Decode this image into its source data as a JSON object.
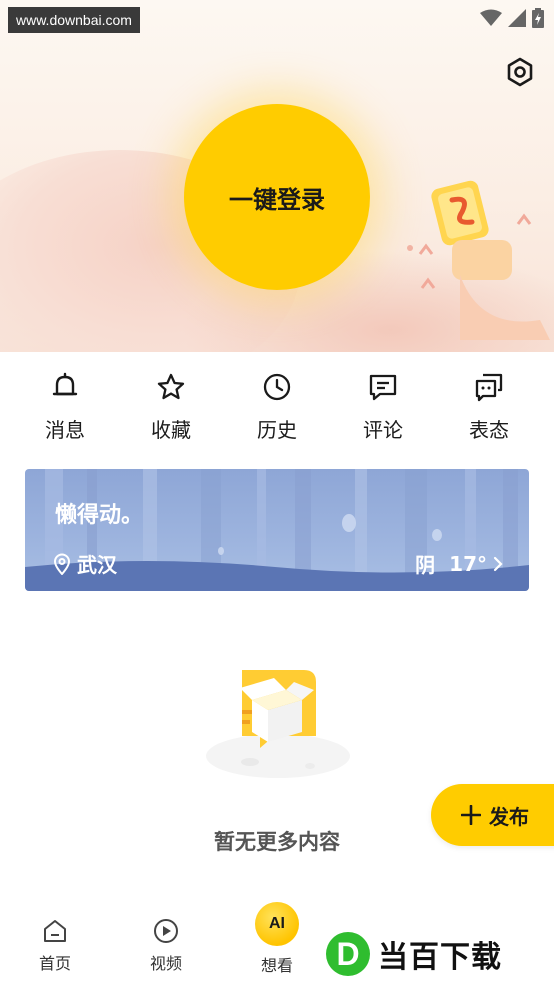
{
  "watermark_top": "www.downbai.com",
  "login": {
    "label": "一键登录"
  },
  "quick_actions": [
    {
      "label": "消息",
      "icon": "bell-icon"
    },
    {
      "label": "收藏",
      "icon": "star-icon"
    },
    {
      "label": "历史",
      "icon": "clock-icon"
    },
    {
      "label": "评论",
      "icon": "comment-icon"
    },
    {
      "label": "表态",
      "icon": "reaction-icon"
    }
  ],
  "weather": {
    "title": "懒得动。",
    "location": "武汉",
    "condition": "阴",
    "temperature": "17°"
  },
  "empty_state": {
    "text": "暂无更多内容"
  },
  "publish": {
    "label": "发布"
  },
  "bottom_nav": [
    {
      "label": "首页",
      "icon": "home-icon"
    },
    {
      "label": "视频",
      "icon": "play-icon"
    },
    {
      "label": "想看",
      "icon": "ai-icon",
      "badge": "AI"
    }
  ],
  "watermark_brand": {
    "logo": "D",
    "text": "当百下载"
  },
  "colors": {
    "accent": "#ffcc00",
    "weather_bg": "#9cb3de",
    "brand_green": "#2fbd2f"
  }
}
